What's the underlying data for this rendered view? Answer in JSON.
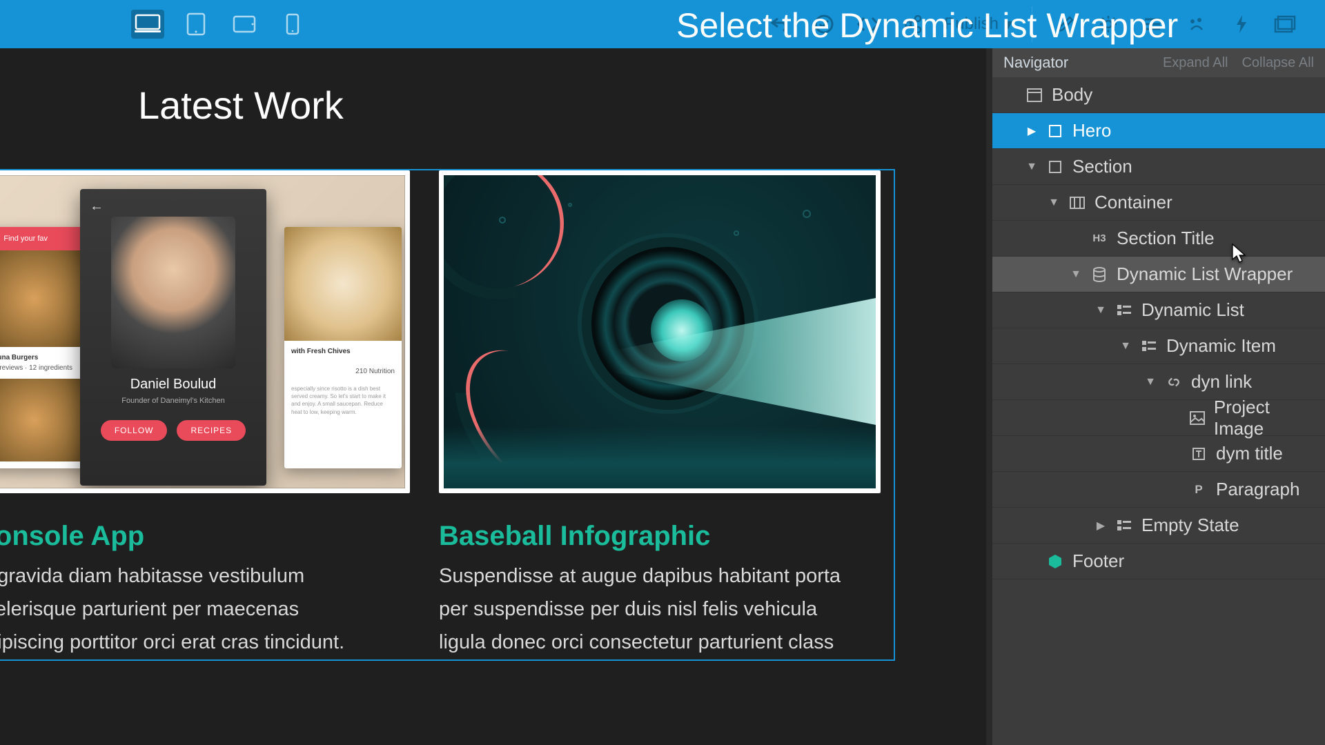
{
  "instruction": "Select the Dynamic List Wrapper",
  "toolbar": {
    "publish_label": "Publish"
  },
  "canvas": {
    "section_title": "Latest Work",
    "cards": [
      {
        "title": "Console App",
        "desc": "Id gravida diam habitasse vestibulum scelerisque parturient per maecenas adipiscing porttitor orci erat cras tincidunt.",
        "chef_name": "Daniel Boulud",
        "chef_sub": "Founder of Daneimyl's Kitchen",
        "btn_follow": "FOLLOW",
        "btn_recipes": "RECIPES",
        "side_header": "Find your fav",
        "side_item1": "Tuna Burgers",
        "side_item2": "with Fresh Chives",
        "side_stat": "210 Nutrition"
      },
      {
        "title": "Baseball Infographic",
        "desc": "Suspendisse at augue dapibus habitant porta per suspendisse per duis nisl felis vehicula ligula donec orci consectetur parturient class"
      }
    ]
  },
  "navigator": {
    "title": "Navigator",
    "expand": "Expand All",
    "collapse": "Collapse All",
    "nodes": [
      {
        "label": "Body",
        "icon": "layout",
        "indent": 0,
        "arrow": "none"
      },
      {
        "label": "Hero",
        "icon": "section",
        "indent": 1,
        "arrow": "right",
        "selected": true
      },
      {
        "label": "Section",
        "icon": "section",
        "indent": 1,
        "arrow": "down"
      },
      {
        "label": "Container",
        "icon": "container",
        "indent": 2,
        "arrow": "down"
      },
      {
        "label": "Section Title",
        "icon": "h3",
        "indent": 3,
        "arrow": "none"
      },
      {
        "label": "Dynamic List Wrapper",
        "icon": "db",
        "indent": 3,
        "arrow": "down",
        "hovered": true
      },
      {
        "label": "Dynamic List",
        "icon": "dlist",
        "indent": 4,
        "arrow": "down"
      },
      {
        "label": "Dynamic Item",
        "icon": "dlist",
        "indent": 5,
        "arrow": "down"
      },
      {
        "label": "dyn link",
        "icon": "link",
        "indent": 6,
        "arrow": "down"
      },
      {
        "label": "Project Image",
        "icon": "image",
        "indent": 7,
        "arrow": "none"
      },
      {
        "label": "dym title",
        "icon": "text",
        "indent": 7,
        "arrow": "none"
      },
      {
        "label": "Paragraph",
        "icon": "p",
        "indent": 7,
        "arrow": "none"
      },
      {
        "label": "Empty State",
        "icon": "dlist",
        "indent": 4,
        "arrow": "right"
      },
      {
        "label": "Footer",
        "icon": "footer",
        "indent": 1,
        "arrow": "none"
      }
    ]
  }
}
